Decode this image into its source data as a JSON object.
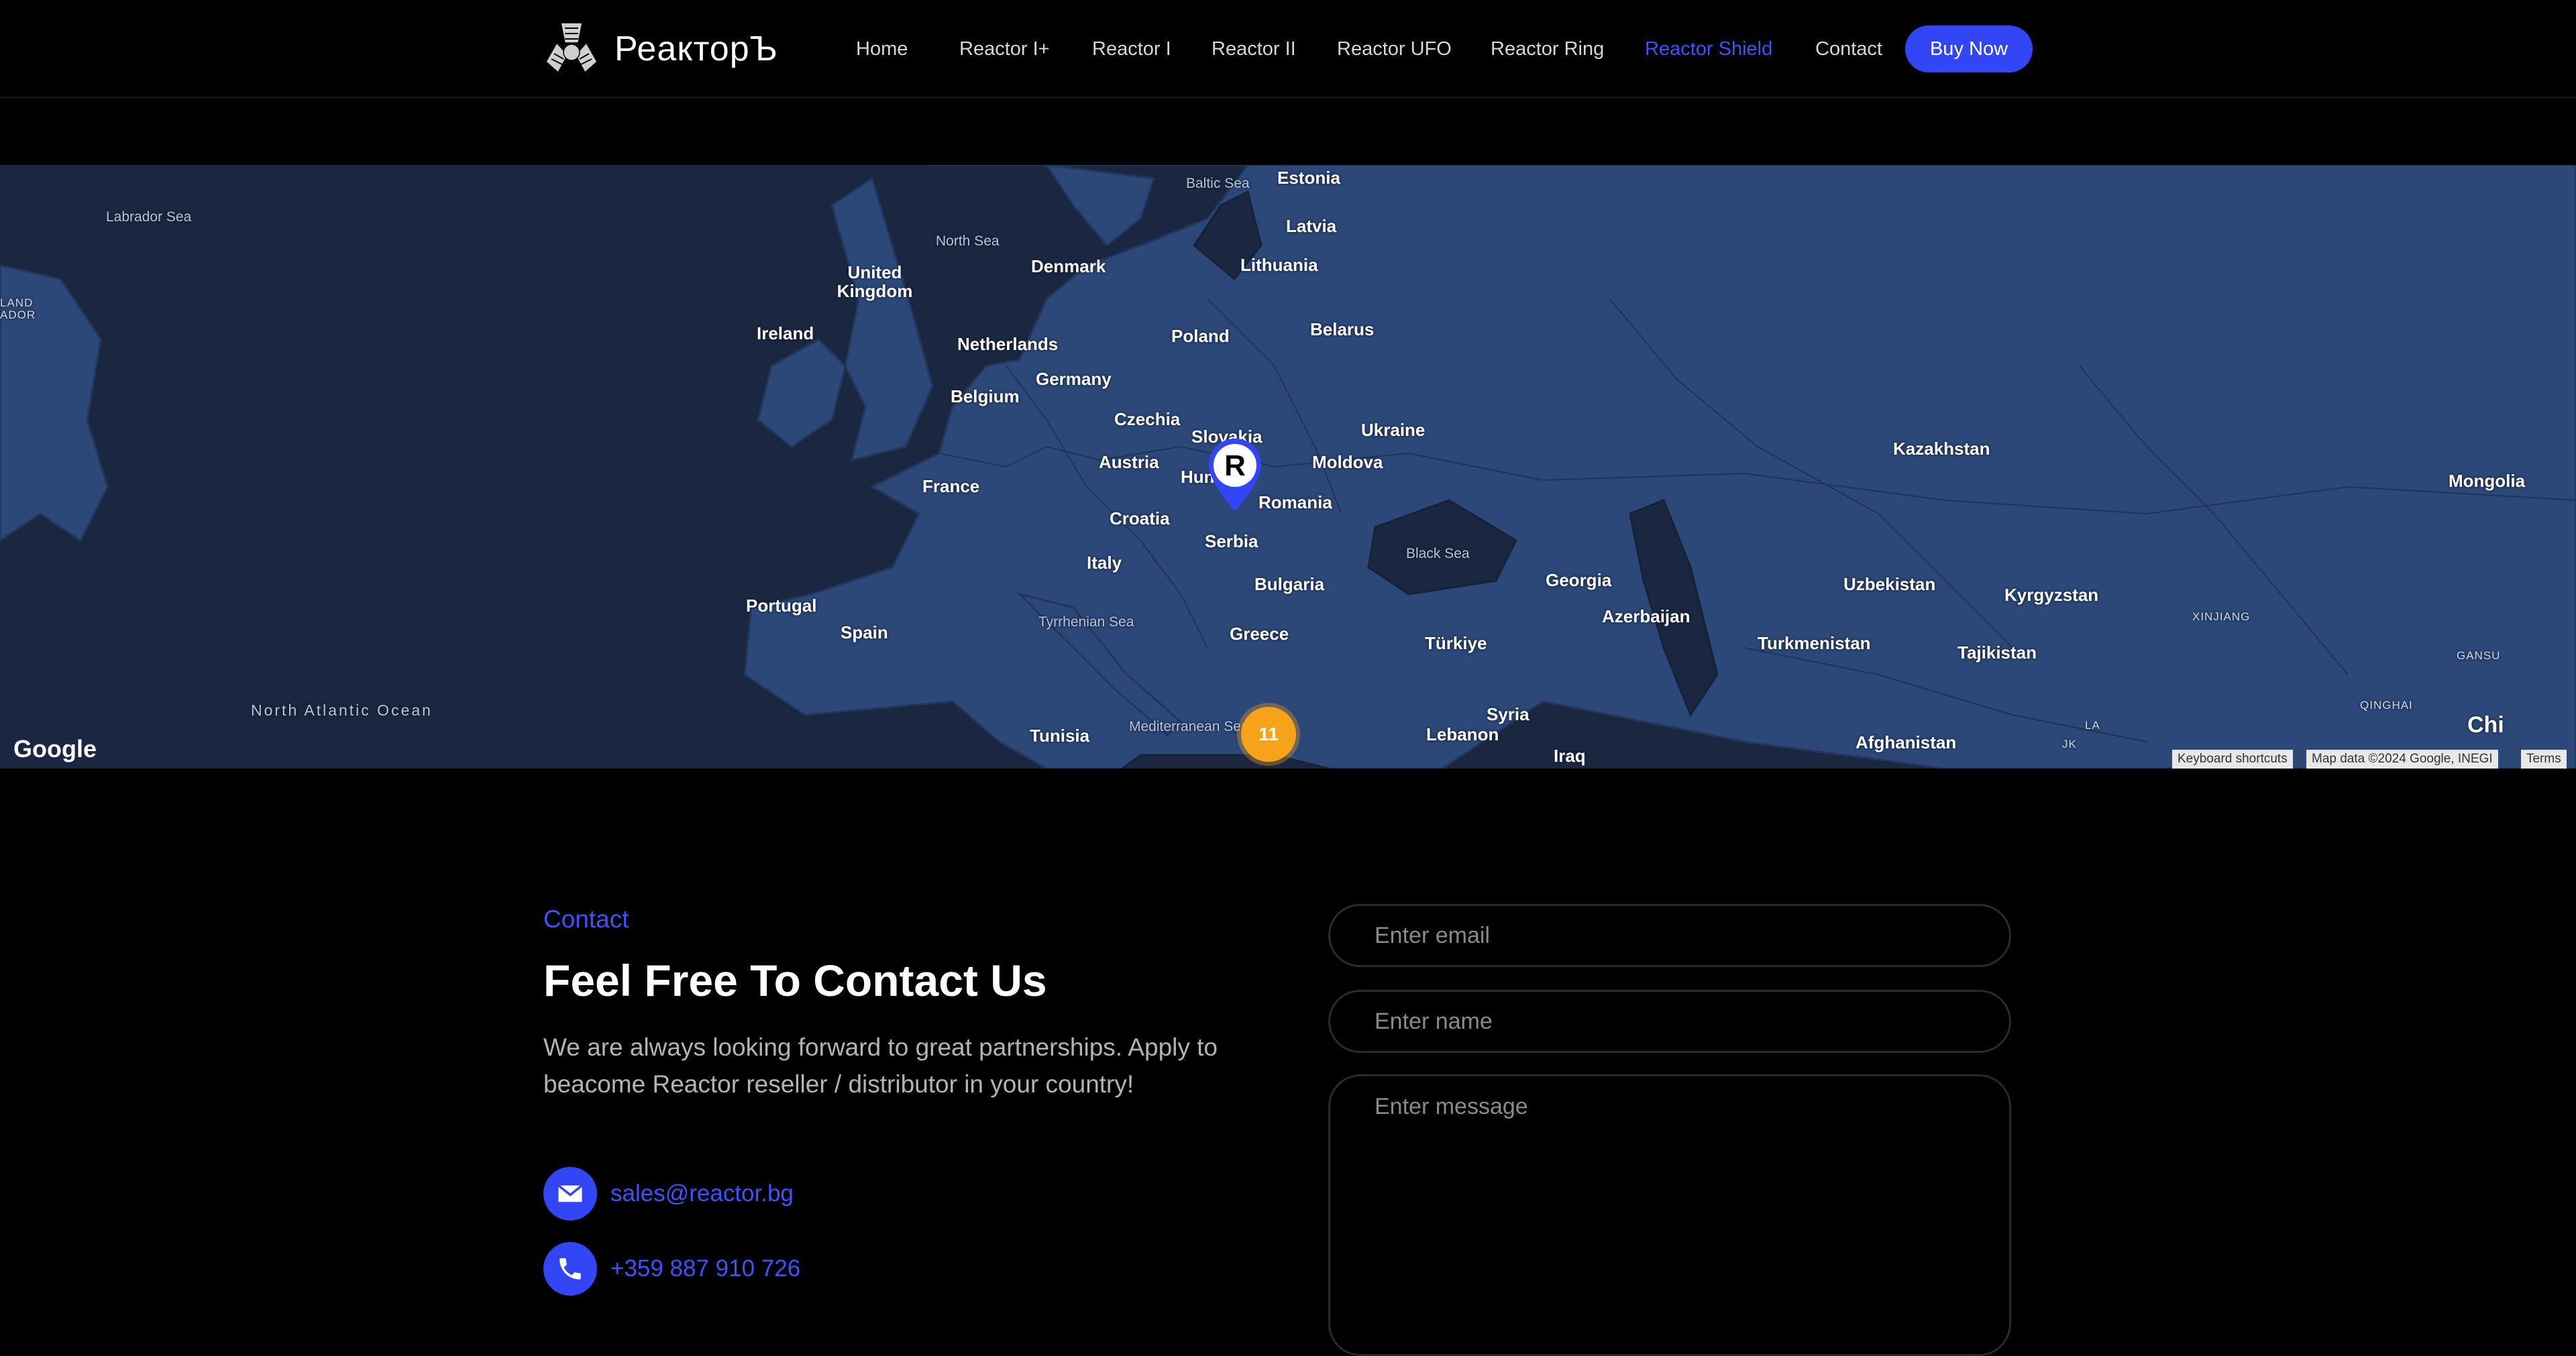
{
  "brand": {
    "name": "РеакторЪ",
    "logo_icon": "reactor-logo-icon"
  },
  "nav": {
    "items": [
      {
        "label": "Home",
        "active": false
      },
      {
        "label": "Reactor I+",
        "active": false
      },
      {
        "label": "Reactor I",
        "active": false
      },
      {
        "label": "Reactor II",
        "active": false
      },
      {
        "label": "Reactor UFO",
        "active": false
      },
      {
        "label": "Reactor Ring",
        "active": false
      },
      {
        "label": "Reactor Shield",
        "active": true
      },
      {
        "label": "Contact",
        "active": false
      }
    ],
    "buy_label": "Buy Now"
  },
  "map": {
    "countries": [
      "Estonia",
      "Latvia",
      "Lithuania",
      "United Kingdom",
      "Denmark",
      "Ireland",
      "Netherlands",
      "Poland",
      "Belarus",
      "Germany",
      "Belgium",
      "Czechia",
      "Slovakia",
      "Ukraine",
      "Austria",
      "Moldova",
      "France",
      "Hungary",
      "Romania",
      "Kazakhstan",
      "Mongolia",
      "Croatia",
      "Serbia",
      "Italy",
      "Bulgaria",
      "Georgia",
      "Azerbaijan",
      "Uzbekistan",
      "Kyrgyzstan",
      "Portugal",
      "Spain",
      "Greece",
      "Türkiye",
      "Turkmenistan",
      "Tajikistan",
      "Syria",
      "Tunisia",
      "Lebanon",
      "Afghanistan",
      "Iraq",
      "Chi"
    ],
    "seas": [
      "Baltic Sea",
      "North Sea",
      "Labrador Sea",
      "Black Sea",
      "Tyrrhenian Sea",
      "Mediterranean Sea"
    ],
    "ocean": "North Atlantic Ocean",
    "regions": [
      "LAND",
      "ADOR",
      "XINJIANG",
      "GANSU",
      "QINGHAI"
    ],
    "region_marks": [
      "LA",
      "JK"
    ],
    "cluster_count": "11",
    "marker_letter": "R",
    "zoom_in": "+",
    "zoom_out": "−",
    "provider": "Google",
    "attribution": {
      "shortcuts": "Keyboard shortcuts",
      "data": "Map data ©2024 Google, INEGI",
      "terms": "Terms"
    }
  },
  "contact": {
    "tag": "Contact",
    "title": "Feel Free To Contact Us",
    "text": "We are always looking forward to great partnerships. Apply to beacome Reactor reseller / distributor in your country!",
    "email": "sales@reactor.bg",
    "phone": "+359 887 910 726",
    "email_icon": "mail-icon",
    "phone_icon": "phone-icon"
  },
  "form": {
    "email_placeholder": "Enter email",
    "name_placeholder": "Enter name",
    "message_placeholder": "Enter message"
  }
}
